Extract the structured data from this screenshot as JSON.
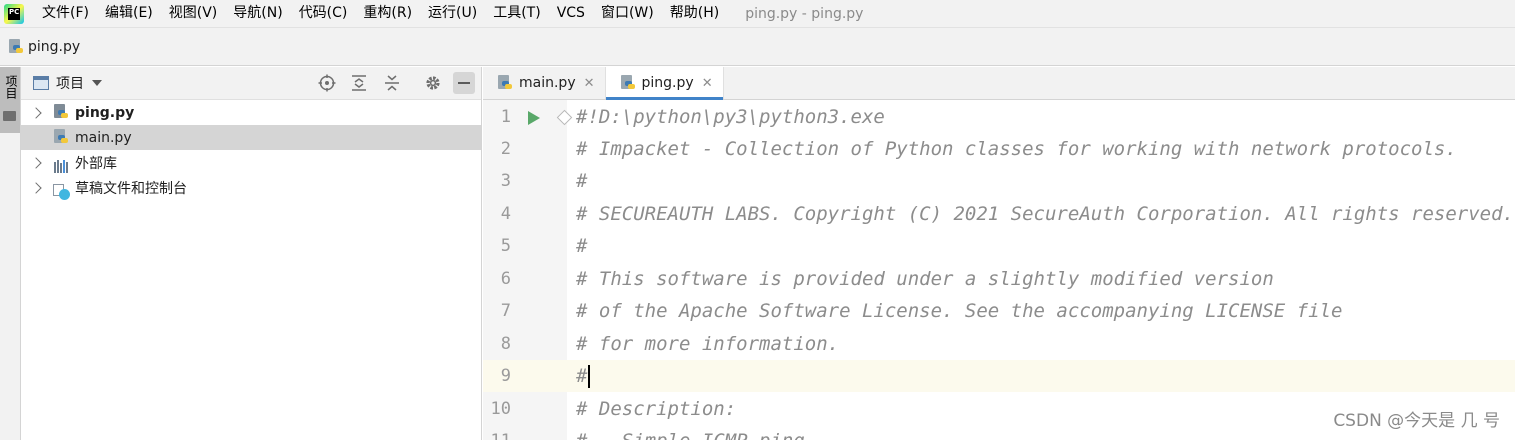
{
  "menubar": {
    "items": [
      "文件(F)",
      "编辑(E)",
      "视图(V)",
      "导航(N)",
      "代码(C)",
      "重构(R)",
      "运行(U)",
      "工具(T)",
      "VCS",
      "窗口(W)",
      "帮助(H)"
    ],
    "window_title": "ping.py - ping.py",
    "logo_text": "PC"
  },
  "navbar": {
    "file": "ping.py"
  },
  "toolstripe": {
    "project_label": "项目"
  },
  "project_panel": {
    "title": "项目",
    "tree": [
      {
        "label": "ping.py",
        "bold": true,
        "expandable": true,
        "icon": "python-project-icon"
      },
      {
        "label": "main.py",
        "bold": false,
        "expandable": false,
        "selected": true,
        "icon": "python-file-icon"
      },
      {
        "label": "外部库",
        "bold": false,
        "expandable": true,
        "icon": "library-icon"
      },
      {
        "label": "草稿文件和控制台",
        "bold": false,
        "expandable": true,
        "icon": "scratch-icon"
      }
    ]
  },
  "editor": {
    "tabs": [
      {
        "label": "main.py",
        "active": false
      },
      {
        "label": "ping.py",
        "active": true
      }
    ],
    "lines": [
      {
        "num": "1",
        "text": "#!D:\\python\\py3\\python3.exe"
      },
      {
        "num": "2",
        "text": "# Impacket - Collection of Python classes for working with network protocols."
      },
      {
        "num": "3",
        "text": "#"
      },
      {
        "num": "4",
        "text": "# SECUREAUTH LABS. Copyright (C) 2021 SecureAuth Corporation. All rights reserved."
      },
      {
        "num": "5",
        "text": "#"
      },
      {
        "num": "6",
        "text": "# This software is provided under a slightly modified version"
      },
      {
        "num": "7",
        "text": "# of the Apache Software License. See the accompanying LICENSE file"
      },
      {
        "num": "8",
        "text": "# for more information."
      },
      {
        "num": "9",
        "text": "#"
      },
      {
        "num": "10",
        "text": "# Description:"
      },
      {
        "num": "11",
        "text": "#   Simple ICMP ping."
      }
    ],
    "current_line": "9"
  },
  "watermark": "CSDN @今天是 几 号"
}
